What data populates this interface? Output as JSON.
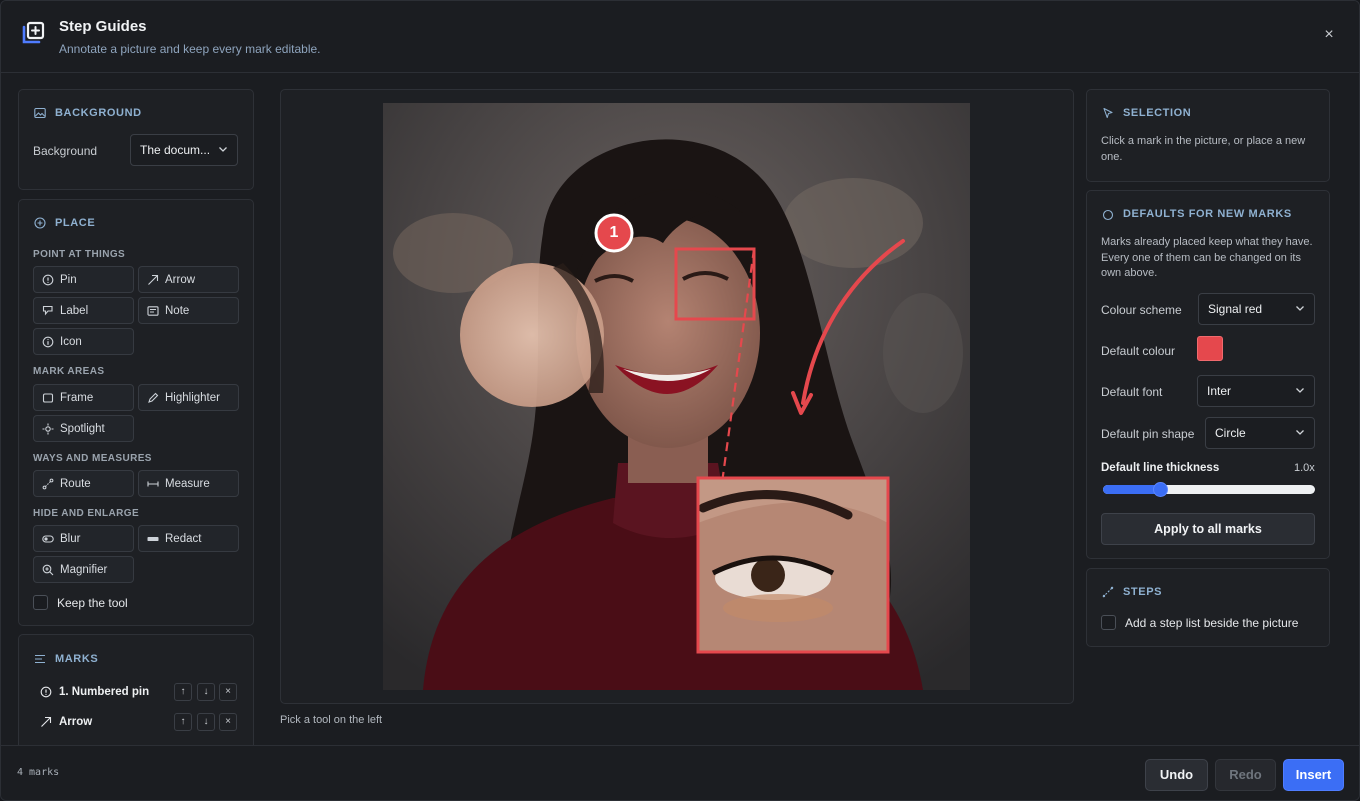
{
  "header": {
    "title": "Step Guides",
    "subtitle": "Annotate a picture and keep every mark editable.",
    "close_glyph": "×"
  },
  "background_section": {
    "title": "BACKGROUND",
    "label": "Background",
    "value": "The docum..."
  },
  "place_section": {
    "title": "PLACE",
    "groups": [
      {
        "label": "POINT AT THINGS",
        "tools": [
          "Pin",
          "Arrow",
          "Label",
          "Note",
          "Icon"
        ]
      },
      {
        "label": "MARK AREAS",
        "tools": [
          "Frame",
          "Highlighter",
          "Spotlight"
        ]
      },
      {
        "label": "WAYS AND MEASURES",
        "tools": [
          "Route",
          "Measure"
        ]
      },
      {
        "label": "HIDE AND ENLARGE",
        "tools": [
          "Blur",
          "Redact",
          "Magnifier"
        ]
      }
    ],
    "keep_tool_label": "Keep the tool"
  },
  "marks_section": {
    "title": "MARKS",
    "items": [
      {
        "label": "1. Numbered pin",
        "icon": "pin-icon"
      },
      {
        "label": "Arrow",
        "icon": "arrow-icon"
      }
    ],
    "up": "↑",
    "down": "↓",
    "remove": "×"
  },
  "canvas": {
    "pin_number": "1",
    "hint": "Pick a tool on the left"
  },
  "selection_section": {
    "title": "SELECTION",
    "text": "Click a mark in the picture, or place a new one."
  },
  "defaults_section": {
    "title": "DEFAULTS FOR NEW MARKS",
    "text": "Marks already placed keep what they have. Every one of them can be changed on its own above.",
    "colour_scheme_label": "Colour scheme",
    "colour_scheme_value": "Signal red",
    "default_colour_label": "Default colour",
    "default_colour": "#e5484d",
    "default_font_label": "Default font",
    "default_font_value": "Inter",
    "pin_shape_label": "Default pin shape",
    "pin_shape_value": "Circle",
    "line_thickness_label": "Default line thickness",
    "line_thickness_value": "1.0x",
    "line_thickness_fraction": 0.27,
    "apply_label": "Apply to all marks"
  },
  "steps_section": {
    "title": "STEPS",
    "checkbox_label": "Add a step list beside the picture"
  },
  "footer": {
    "count": "4 marks",
    "undo": "Undo",
    "redo": "Redo",
    "insert": "Insert"
  },
  "colors": {
    "accent": "#3b6ef5",
    "mark_red": "#e5484d",
    "section_title": "#8fb1d1"
  }
}
